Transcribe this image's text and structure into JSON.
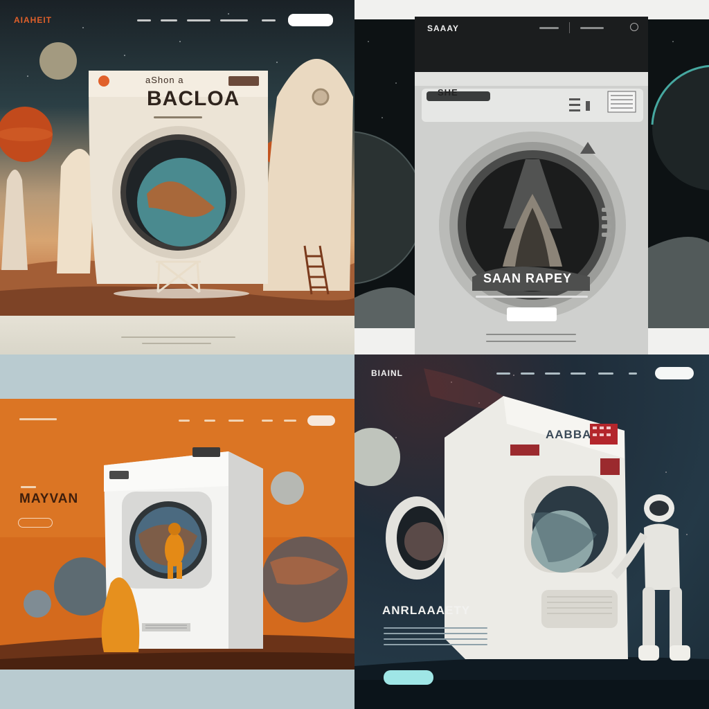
{
  "panel1": {
    "logo": "AIAHEIT",
    "nav_button": "",
    "machine_small_text": "aShon a",
    "machine_title": "BACLOA",
    "machine_subtitle": "",
    "colors": {
      "accent": "#e0602a",
      "sky": "#2b3f45",
      "ground": "#c47a4a"
    }
  },
  "panel2": {
    "logo": "SAAAY",
    "machine_label": "SHE",
    "hero_title": "SAAN RAPEY",
    "hero_subtitle": "",
    "cta_button": "",
    "icons": [
      "search-icon"
    ],
    "colors": {
      "header": "#1b1d1e",
      "machine": "#d9d9d7"
    }
  },
  "panel3": {
    "logo": "",
    "hero_title": "MAYVAN",
    "cta_button": "",
    "nav_button": "",
    "colors": {
      "band": "#d86f1e",
      "machine": "#f4f4f2",
      "suit": "#e48a16"
    }
  },
  "panel4": {
    "logo": "BIAINL",
    "machine_title": "AABBA",
    "hero_title": "ANRLAAAETY",
    "nav_button": "",
    "cta_button": "",
    "colors": {
      "accent": "#9fe6e6",
      "machine": "#ecebe6"
    }
  }
}
